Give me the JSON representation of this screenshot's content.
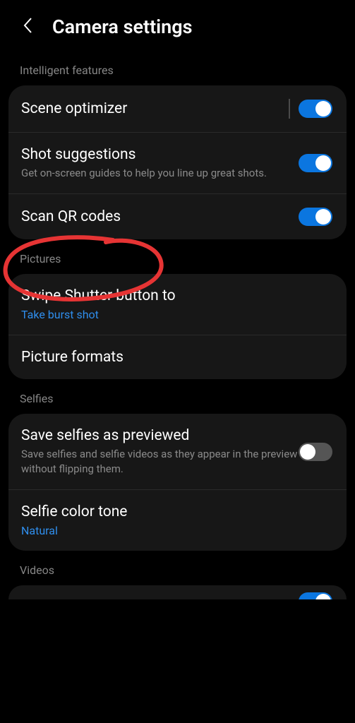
{
  "header": {
    "title": "Camera settings"
  },
  "sections": {
    "intelligent_features": {
      "label": "Intelligent features",
      "scene_optimizer": {
        "title": "Scene optimizer",
        "enabled": true
      },
      "shot_suggestions": {
        "title": "Shot suggestions",
        "subtitle": "Get on-screen guides to help you line up great shots.",
        "enabled": true
      },
      "scan_qr": {
        "title": "Scan QR codes",
        "enabled": true
      }
    },
    "pictures": {
      "label": "Pictures",
      "swipe_shutter": {
        "title": "Swipe Shutter button to",
        "value": "Take burst shot"
      },
      "picture_formats": {
        "title": "Picture formats"
      }
    },
    "selfies": {
      "label": "Selfies",
      "save_previewed": {
        "title": "Save selfies as previewed",
        "subtitle": "Save selfies and selfie videos as they appear in the preview without flipping them.",
        "enabled": false
      },
      "color_tone": {
        "title": "Selfie color tone",
        "value": "Natural"
      }
    },
    "videos": {
      "label": "Videos"
    }
  },
  "annotation": {
    "color": "#e63434"
  }
}
